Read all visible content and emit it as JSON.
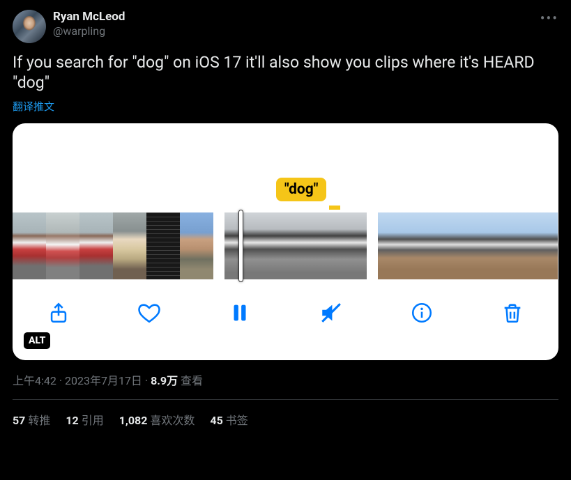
{
  "author": {
    "name": "Ryan McLeod",
    "handle": "@warpling"
  },
  "body": "If you search for \"dog\" on iOS 17 it'll also show you clips where it's HEARD \"dog\"",
  "translate_label": "翻译推文",
  "media": {
    "search_label": "\"dog\"",
    "alt_badge": "ALT"
  },
  "meta": {
    "time": "上午4:42",
    "sep1": " · ",
    "date": "2023年7月17日",
    "sep2": " · ",
    "views_count": "8.9万",
    "views_label": " 查看"
  },
  "stats": {
    "retweets_n": "57",
    "retweets_l": "转推",
    "quotes_n": "12",
    "quotes_l": "引用",
    "likes_n": "1,082",
    "likes_l": "喜欢次数",
    "bookmarks_n": "45",
    "bookmarks_l": "书签"
  }
}
